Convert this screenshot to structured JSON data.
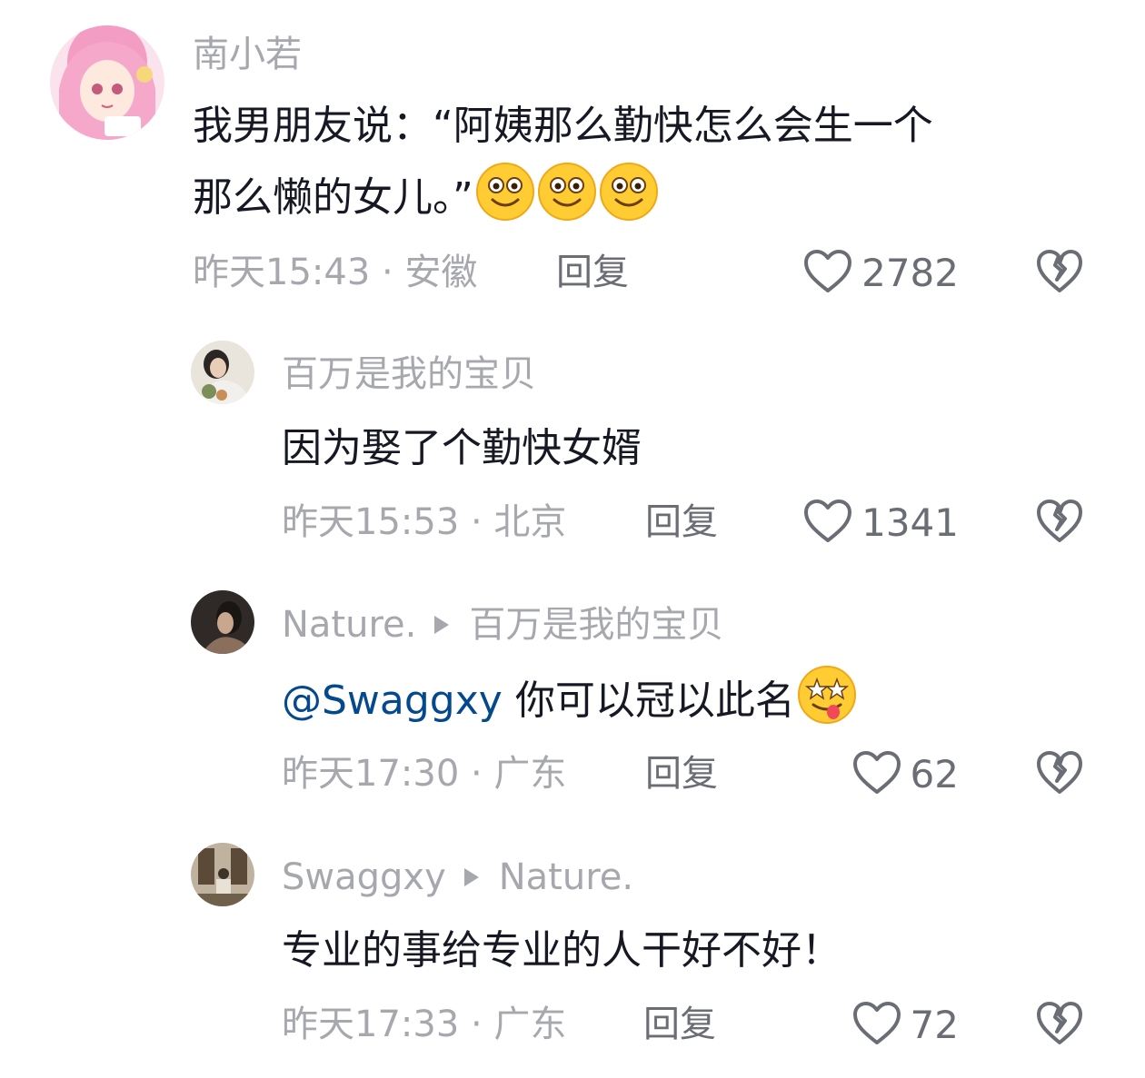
{
  "comments": [
    {
      "username": "南小若",
      "reply_to": "",
      "text": "我男朋友说：“阿姨那么勤快怎么会生一个",
      "text_line2": "那么懒的女儿。”",
      "emojis": [
        "grin-emoji",
        "grin-emoji",
        "grin-emoji"
      ],
      "time_location": "昨天15:43 · 安徽",
      "reply_label": "回复",
      "likes": "2782",
      "avatar_color": "#f6b9d4"
    },
    {
      "username": "百万是我的宝贝",
      "reply_to": "",
      "text": "因为娶了个勤快女婿",
      "time_location": "昨天15:53 · 北京",
      "reply_label": "回复",
      "likes": "1341",
      "avatar_color": "#c9c3b8"
    },
    {
      "username": "Nature.",
      "reply_to": "百万是我的宝贝",
      "mention": "@Swaggxy",
      "text": " 你可以冠以此名",
      "emojis": [
        "drooling-star-emoji"
      ],
      "time_location": "昨天17:30 · 广东",
      "reply_label": "回复",
      "likes": "62",
      "avatar_color": "#3b3634"
    },
    {
      "username": "Swaggxy",
      "reply_to": "Nature.",
      "text": "专业的事给专业的人干好不好！",
      "time_location": "昨天17:33 · 广东",
      "reply_label": "回复",
      "likes": "72",
      "avatar_color": "#8a7b63"
    }
  ],
  "colors": {
    "text": "#161823",
    "meta": "#a7a8ad",
    "mention": "#04498d",
    "action": "#6b6d75"
  }
}
